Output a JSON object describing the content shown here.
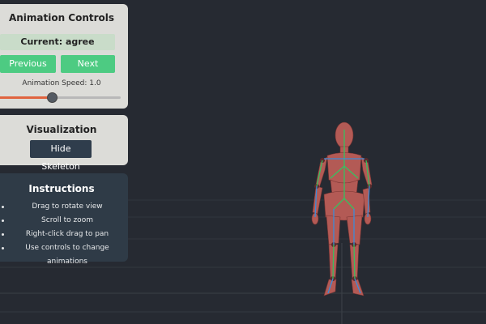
{
  "animation_controls": {
    "title": "Animation Controls",
    "current_label": "Current: agree",
    "previous_label": "Previous",
    "next_label": "Next",
    "speed_label": "Animation Speed: 1.0",
    "speed_slider_fraction": 0.45
  },
  "visualization": {
    "title": "Visualization",
    "toggle_skeleton_label": "Hide Skeleton"
  },
  "instructions": {
    "title": "Instructions",
    "items": [
      "Drag to rotate view",
      "Scroll to zoom",
      "Right-click drag to pan",
      "Use controls to change animations"
    ]
  },
  "colors": {
    "background": "#262a32",
    "accent_green": "#4dcb82",
    "slider_fill": "#e0643f",
    "figure_skin": "#b35a55",
    "skeleton_green": "#38c060",
    "skeleton_blue": "#3c8cd8"
  }
}
